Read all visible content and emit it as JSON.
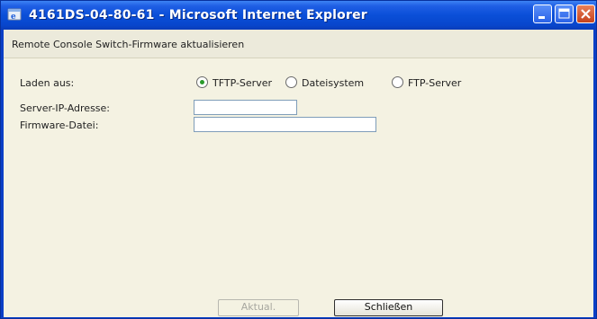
{
  "window": {
    "title": "4161DS-04-80-61 - Microsoft Internet Explorer",
    "controls": [
      "minimize-icon",
      "maximize-icon",
      "close-icon"
    ]
  },
  "page": {
    "title": "Remote Console Switch-Firmware aktualisieren"
  },
  "form": {
    "load_from_label": "Laden aus:",
    "options": [
      {
        "label": "TFTP-Server",
        "selected": true
      },
      {
        "label": "Dateisystem",
        "selected": false
      },
      {
        "label": "FTP-Server",
        "selected": false
      }
    ],
    "server_ip_label": "Server-IP-Adresse:",
    "server_ip_value": "",
    "firmware_file_label": "Firmware-Datei:",
    "firmware_file_value": ""
  },
  "buttons": {
    "update_label": "Aktual.",
    "update_enabled": false,
    "close_label": "Schließen"
  },
  "colors": {
    "titlebar": "#0a4fd8",
    "client_bg": "#f4f2e2",
    "radio_checked": "#2a9a2a"
  }
}
